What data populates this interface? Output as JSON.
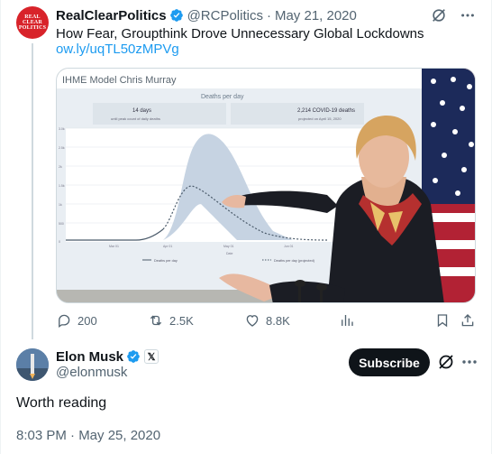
{
  "quoted_tweet": {
    "avatar_text": [
      "REAL",
      "CLEAR",
      "POLITICS"
    ],
    "name": "RealClearPolitics",
    "handle": "@RCPolitics",
    "separator": "·",
    "date": "May 21, 2020",
    "text": "How Fear, Groupthink Drove Unnecessary Global Lockdowns",
    "link": "ow.ly/uqTL50zMPVg",
    "media": {
      "title": "IHME Model Chris Murray",
      "chart_heading": "Deaths per day",
      "stat1_value": "14 days",
      "stat1_label": "until peak count of daily deaths",
      "stat2_value": "2,214 COVID-19 deaths",
      "stat2_label": "projected on April 15, 2020",
      "y_ticks": [
        "3.0k",
        "2.5k",
        "2k",
        "1.5k",
        "1k",
        "500",
        "0"
      ],
      "x_ticks": [
        "Mar 01",
        "Apr 01",
        "May 01",
        "Jun 01",
        "Jul 01"
      ],
      "x_axis_label": "Date",
      "legend_1": "Deaths per day",
      "legend_2": "Deaths per day (projected)"
    },
    "actions": {
      "replies": "200",
      "retweets": "2.5K",
      "likes": "8.8K"
    }
  },
  "main_tweet": {
    "name": "Elon Musk",
    "affiliate_badge": "𝕏",
    "handle": "@elonmusk",
    "subscribe_label": "Subscribe",
    "text": "Worth reading",
    "timestamp": "8:03 PM · May 25, 2020"
  },
  "colors": {
    "accent": "#1d9bf0",
    "secondary_text": "#536471",
    "primary_text": "#0f1419",
    "rcp_red": "#d8232a"
  }
}
